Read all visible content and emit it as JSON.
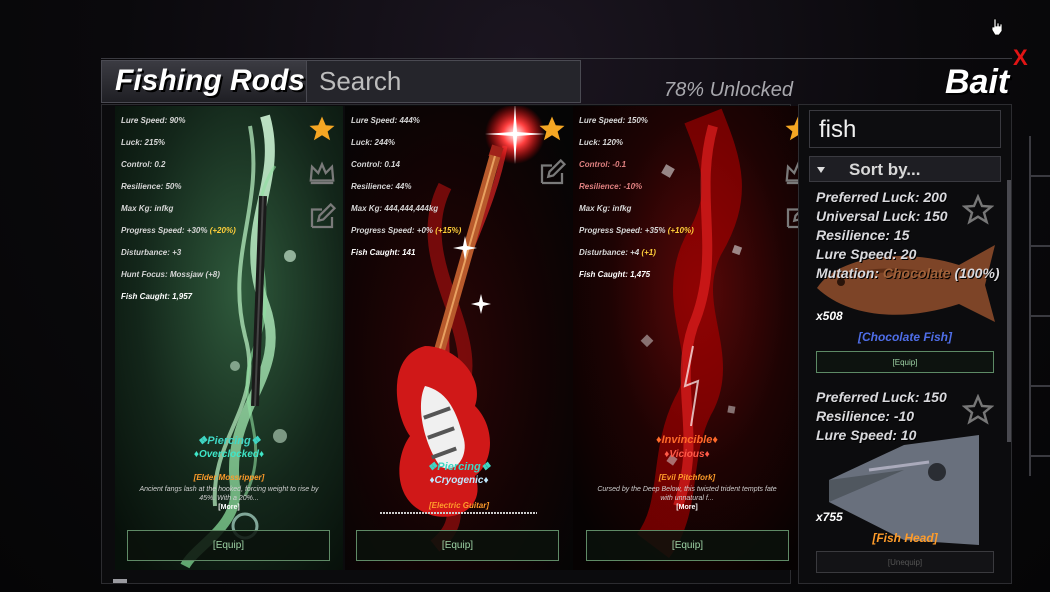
{
  "header": {
    "title": "Fishing Rods",
    "search_placeholder": "Search",
    "unlocked": "78% Unlocked",
    "bait_title": "Bait",
    "close": "X"
  },
  "rods": [
    {
      "stats": [
        {
          "text": "Lure Speed: 90%"
        },
        {
          "text": "Luck: 215%"
        },
        {
          "text": "Control: 0.2"
        },
        {
          "text": "Resilience: 50%"
        },
        {
          "text": "Max Kg: infkg"
        },
        {
          "text": "Progress Speed: +30% ",
          "bonus": "(+20%)"
        },
        {
          "text": "Disturbance: +3"
        },
        {
          "text": "Hunt Focus: Mossjaw (+8)"
        },
        {
          "text": "Fish Caught: 1,957",
          "caught": true
        }
      ],
      "mutation1": "Piercing",
      "mutation2": "Overclocked",
      "name": "[Elder Mossripper]",
      "description": "Ancient fangs lash at the hooked, forcing weight to rise by 45%. With a 20%...",
      "more": "[More]",
      "equip": "[Equip]"
    },
    {
      "stats": [
        {
          "text": "Lure Speed: 444%"
        },
        {
          "text": "Luck: 244%"
        },
        {
          "text": "Control: 0.14"
        },
        {
          "text": "Resilience: 44%"
        },
        {
          "text": "Max Kg: 444,444,444kg"
        },
        {
          "text": "Progress Speed: +0% ",
          "bonus": "(+15%)"
        },
        {
          "text": "Fish Caught: 141",
          "caught": true
        }
      ],
      "mutation1": "Piercing",
      "mutation2": "Cryogenic",
      "name": "[Electric Guitar]",
      "equip": "[Equip]"
    },
    {
      "stats": [
        {
          "text": "Lure Speed: 150%"
        },
        {
          "text": "Luck: 120%"
        },
        {
          "text": "Control: -0.1",
          "neg": true
        },
        {
          "text": "Resilience: -10%",
          "neg": true
        },
        {
          "text": "Max Kg: infkg"
        },
        {
          "text": "Progress Speed: +35% ",
          "bonus": "(+10%)"
        },
        {
          "text": "Disturbance: +4 ",
          "bonus": "(+1)"
        },
        {
          "text": "Fish Caught: 1,475",
          "caught": true
        }
      ],
      "mutation1": "Invincible",
      "mutation2": "Vicious",
      "name": "[Evil Pitchfork]",
      "description": "Cursed by the Deep Below, this twisted trident tempts fate with unnatural f...",
      "more": "[More]",
      "equip": "[Equip]"
    }
  ],
  "bait": {
    "search_value": "fish",
    "sort_label": "Sort by...",
    "items": [
      {
        "stats": [
          "Preferred Luck: 200",
          "Universal Luck: 150",
          "Resilience: 15",
          "Lure Speed: 20"
        ],
        "mutation_prefix": "Mutation: ",
        "mutation_name": "Chocolate",
        "mutation_suffix": " (100%)",
        "count": "x508",
        "name": "[Chocolate Fish]",
        "name_color": "#4f6ee8",
        "button": "[Equip]"
      },
      {
        "stats": [
          "Preferred Luck: 150",
          "Resilience: -10",
          "Lure Speed: 10"
        ],
        "count": "x755",
        "name": "[Fish Head]",
        "name_color": "#ff9c2a",
        "button": "[Unequip]"
      }
    ]
  },
  "colors": {
    "rod_name": "#ff9c2a",
    "piercing": "#3fd6c4",
    "overclocked": "#3fe6c8",
    "cryogenic": "#bfe9ff",
    "invincible": "#ff6a2a",
    "vicious": "#ff5a48",
    "equip_border": "#5f8a66",
    "close": "#e11414"
  }
}
